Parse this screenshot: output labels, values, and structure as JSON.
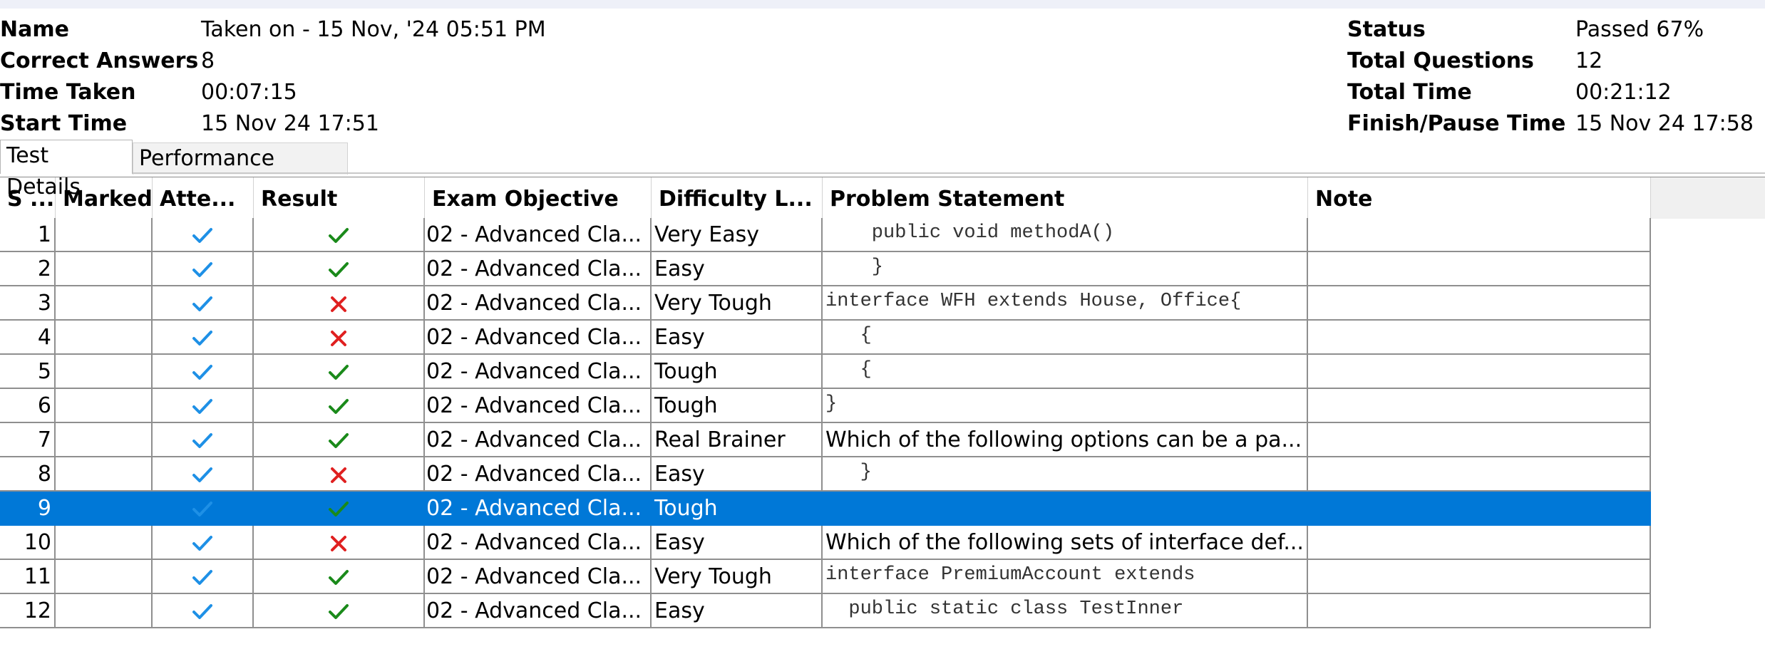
{
  "summary": {
    "left": [
      {
        "label": "Name",
        "value": "Taken on - 15 Nov, '24 05:51 PM"
      },
      {
        "label": "Correct Answers",
        "value": "8"
      },
      {
        "label": "Time Taken",
        "value": "00:07:15"
      },
      {
        "label": "Start Time",
        "value": "15 Nov 24 17:51"
      }
    ],
    "right": [
      {
        "label": "Status",
        "value": "Passed 67%"
      },
      {
        "label": "Total Questions",
        "value": "12"
      },
      {
        "label": "Total Time",
        "value": "00:21:12"
      },
      {
        "label": "Finish/Pause Time",
        "value": "15 Nov 24 17:58"
      }
    ]
  },
  "tabs": [
    "Test Details",
    "Performance Report"
  ],
  "columns": [
    "S ...",
    "Marked",
    "Atte...",
    "Result",
    "Exam Objective",
    "Difficulty L...",
    "Problem Statement",
    "Note"
  ],
  "colors": {
    "check_blue": "#1e90e6",
    "check_green": "#1a8a1a",
    "cross_red": "#e02020",
    "selection": "#0078d7"
  },
  "icons": {
    "attempted": "checkmark-icon",
    "correct": "green-check-icon",
    "incorrect": "red-cross-icon"
  },
  "rows": [
    {
      "sn": "1",
      "attempted": true,
      "result": "correct",
      "objective": "02 - Advanced Cla...",
      "difficulty": "Very Easy",
      "problem": "    public void methodA()",
      "mono": true
    },
    {
      "sn": "2",
      "attempted": true,
      "result": "correct",
      "objective": "02 - Advanced Cla...",
      "difficulty": "Easy",
      "problem": "    }",
      "mono": true
    },
    {
      "sn": "3",
      "attempted": true,
      "result": "incorrect",
      "objective": "02 - Advanced Cla...",
      "difficulty": "Very Tough",
      "problem": "interface WFH extends House, Office{",
      "mono": true
    },
    {
      "sn": "4",
      "attempted": true,
      "result": "incorrect",
      "objective": "02 - Advanced Cla...",
      "difficulty": "Easy",
      "problem": "   {",
      "mono": true
    },
    {
      "sn": "5",
      "attempted": true,
      "result": "correct",
      "objective": "02 - Advanced Cla...",
      "difficulty": "Tough",
      "problem": "   {",
      "mono": true
    },
    {
      "sn": "6",
      "attempted": true,
      "result": "correct",
      "objective": "02 - Advanced Cla...",
      "difficulty": "Tough",
      "problem": "}",
      "mono": true
    },
    {
      "sn": "7",
      "attempted": true,
      "result": "correct",
      "objective": "02 - Advanced Cla...",
      "difficulty": "Real Brainer",
      "problem": "Which of the following options can be a pa...",
      "mono": false
    },
    {
      "sn": "8",
      "attempted": true,
      "result": "incorrect",
      "objective": "02 - Advanced Cla...",
      "difficulty": "Easy",
      "problem": "   }",
      "mono": true
    },
    {
      "sn": "9",
      "attempted": true,
      "result": "correct",
      "objective": "02 - Advanced Cla...",
      "difficulty": "Tough",
      "problem": "",
      "mono": false,
      "selected": true
    },
    {
      "sn": "10",
      "attempted": true,
      "result": "incorrect",
      "objective": "02 - Advanced Cla...",
      "difficulty": "Easy",
      "problem": "Which of the following sets of interface def...",
      "mono": false
    },
    {
      "sn": "11",
      "attempted": true,
      "result": "correct",
      "objective": "02 - Advanced Cla...",
      "difficulty": "Very Tough",
      "problem": "interface PremiumAccount extends",
      "mono": true
    },
    {
      "sn": "12",
      "attempted": true,
      "result": "correct",
      "objective": "02 - Advanced Cla...",
      "difficulty": "Easy",
      "problem": "  public static class TestInner",
      "mono": true
    }
  ]
}
